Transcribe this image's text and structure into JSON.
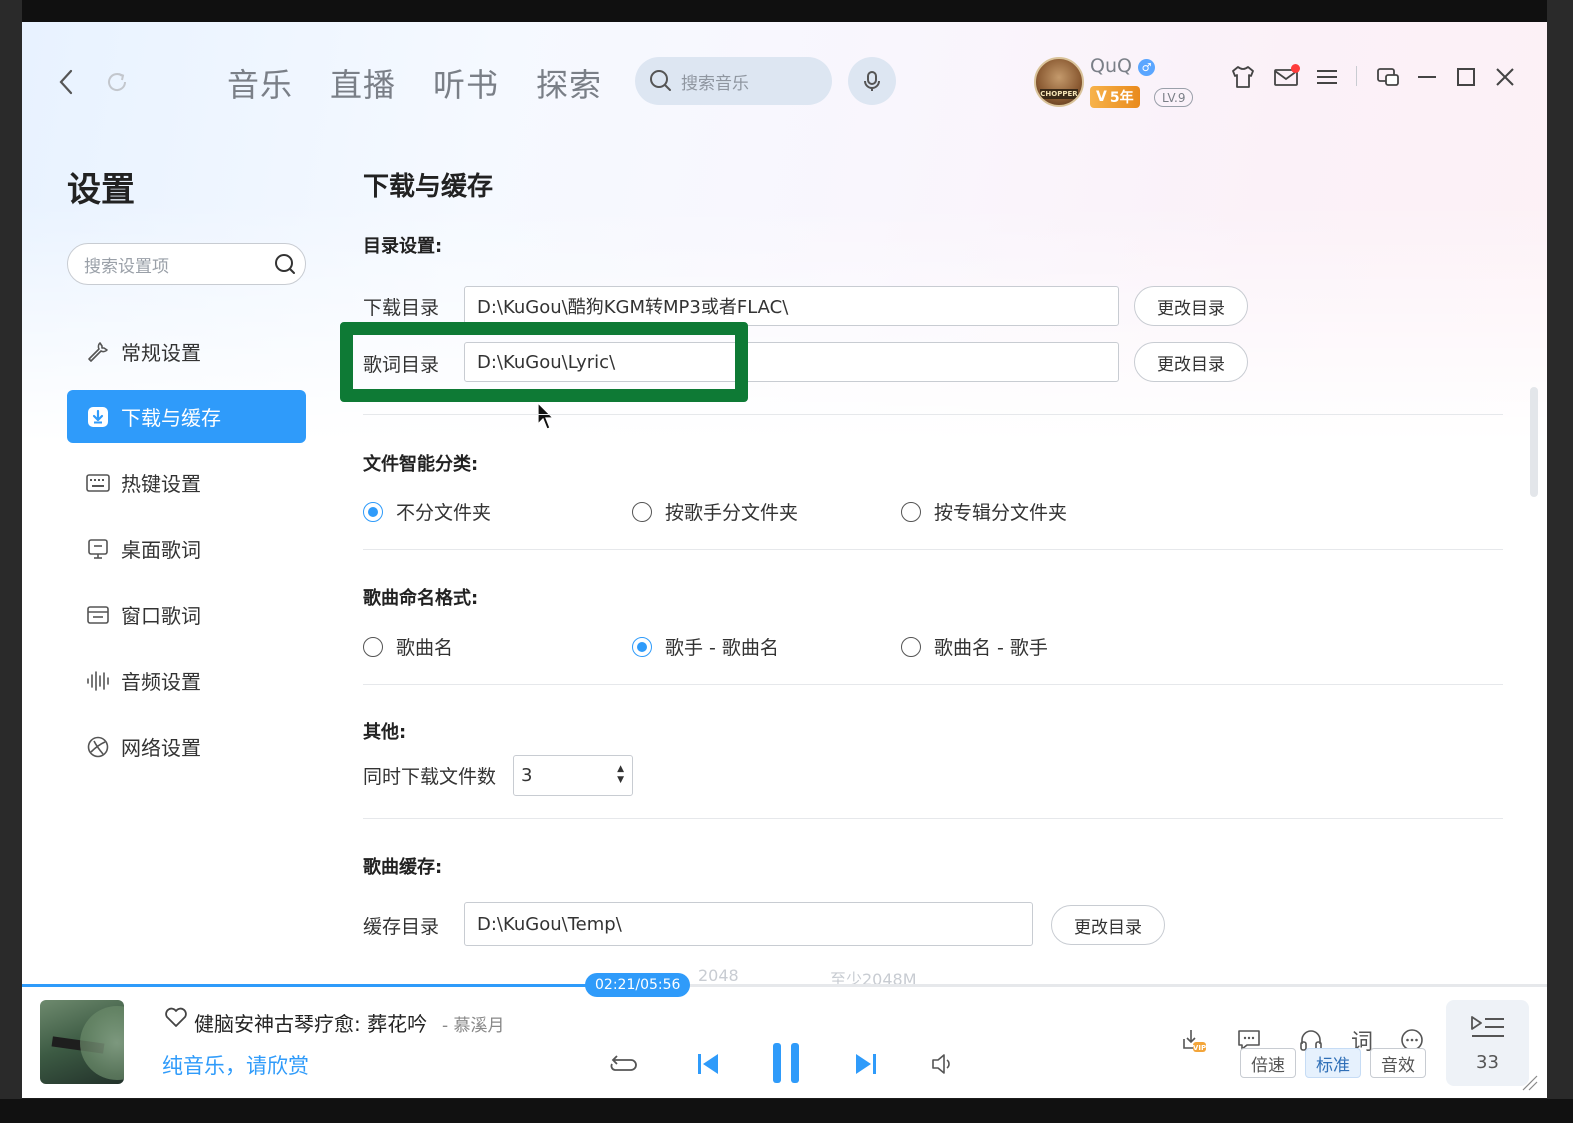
{
  "window": {
    "nav_tabs": [
      "音乐",
      "直播",
      "听书",
      "探索"
    ],
    "search_placeholder": "搜索音乐"
  },
  "user": {
    "name": "QuQ",
    "avatar_text": "CHOPPER",
    "vip": "5年",
    "level": "LV.9"
  },
  "sidebar": {
    "title": "设置",
    "search_placeholder": "搜索设置项",
    "items": [
      {
        "label": "常规设置",
        "icon": "wrench-icon"
      },
      {
        "label": "下载与缓存",
        "icon": "download-icon",
        "active": true
      },
      {
        "label": "热键设置",
        "icon": "keyboard-icon"
      },
      {
        "label": "桌面歌词",
        "icon": "monitor-icon"
      },
      {
        "label": "窗口歌词",
        "icon": "window-icon"
      },
      {
        "label": "音频设置",
        "icon": "waveform-icon"
      },
      {
        "label": "网络设置",
        "icon": "globe-icon"
      }
    ]
  },
  "content": {
    "title": "下载与缓存",
    "dir_section": "目录设置:",
    "download_dir_label": "下载目录",
    "download_dir": "D:\\KuGou\\酷狗KGM转MP3或者FLAC\\",
    "lyric_dir_label": "歌词目录",
    "lyric_dir": "D:\\KuGou\\Lyric\\",
    "change_btn": "更改目录",
    "classify_section": "文件智能分类:",
    "classify_options": [
      "不分文件夹",
      "按歌手分文件夹",
      "按专辑分文件夹"
    ],
    "naming_section": "歌曲命名格式:",
    "naming_options": [
      "歌曲名",
      "歌手 - 歌曲名",
      "歌曲名 - 歌手"
    ],
    "other_section": "其他:",
    "concurrent_label": "同时下载文件数",
    "concurrent_value": "3",
    "cache_section": "歌曲缓存:",
    "cache_dir_label": "缓存目录",
    "cache_dir": "D:\\KuGou\\Temp\\",
    "cache_size_faded": "2048",
    "cache_min_faded": "至少2048M"
  },
  "player": {
    "time": "02:21/05:56",
    "progress": 0.396,
    "song_title": "健脑安神古琴疗愈: 葬花吟",
    "artist": "- 慕溪月",
    "lyric": "纯音乐，请欣赏",
    "speed_label": "倍速",
    "quality_label": "标准",
    "effect_label": "音效",
    "lyric_btn": "词",
    "queue_count": "33"
  },
  "colors": {
    "accent": "#2f9bfa",
    "highlight_box": "#0e7a35"
  }
}
